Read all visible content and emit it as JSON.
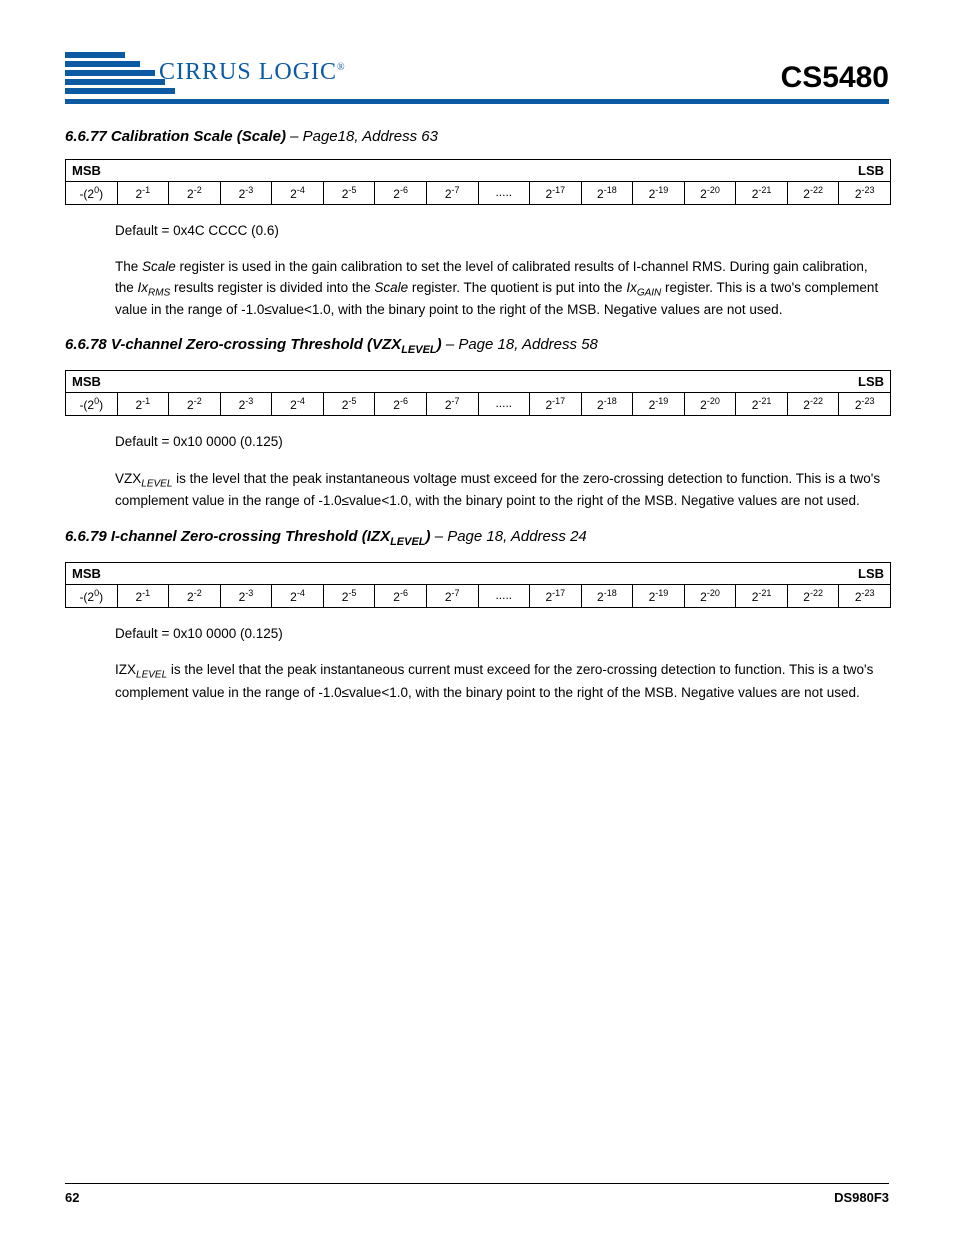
{
  "header": {
    "logo_text": "CIRRUS LOGIC",
    "chip": "CS5480"
  },
  "sections": [
    {
      "num": "6.6.77",
      "title_main": "Calibration Scale (Scale)",
      "title_suffix": " – Page18, Address 63",
      "default_line": "Default = 0x4C CCCC (0.6)",
      "body_parts": [
        "The ",
        {
          "ital": "Scale"
        },
        " register is used in the gain calibration to set the level of calibrated results of I-channel RMS. During gain calibration, the ",
        {
          "ital": "Ix"
        },
        {
          "sub": "RMS"
        },
        " results register is divided into the ",
        {
          "ital": "Scale"
        },
        " register. The quotient is put into the ",
        {
          "ital": "Ix"
        },
        {
          "sub": "GAIN"
        },
        " register. This is a two's complement value in the range of -1.0≤value<1.0, with the binary point to the right of the MSB. Negative values are not used."
      ]
    },
    {
      "num": "6.6.78",
      "title_main": "V-channel Zero-crossing Threshold (VZX",
      "title_sub": "LEVEL",
      "title_close": ")",
      "title_suffix": " – Page 18, Address 58",
      "default_line": "Default = 0x10 0000 (0.125)",
      "body_parts": [
        "VZX",
        {
          "sub": "LEVEL"
        },
        " is the level that the peak instantaneous voltage must exceed for the zero-crossing detection to function. This is a two's complement value in the range of -1.0≤value<1.0, with the binary point to the right of the MSB. Negative values are not used."
      ]
    },
    {
      "num": "6.6.79",
      "title_main": "I-channel Zero-crossing Threshold (IZX",
      "title_sub": "LEVEL",
      "title_close": ")",
      "title_suffix": " – Page 18, Address 24",
      "default_line": "Default = 0x10 0000 (0.125)",
      "body_parts": [
        "IZX",
        {
          "sub": "LEVEL"
        },
        " is the level that the peak instantaneous current must exceed for the zero-crossing detection to function. This is a two's complement value in the range of -1.0≤value<1.0, with the binary point to the right of the MSB. Negative values are not used."
      ]
    }
  ],
  "bit_labels": {
    "msb": "MSB",
    "lsb": "LSB",
    "cells": [
      {
        "text": "-(2",
        "sup": "0",
        "close": ")"
      },
      {
        "text": "2",
        "sup": "-1"
      },
      {
        "text": "2",
        "sup": "-2"
      },
      {
        "text": "2",
        "sup": "-3"
      },
      {
        "text": "2",
        "sup": "-4"
      },
      {
        "text": "2",
        "sup": "-5"
      },
      {
        "text": "2",
        "sup": "-6"
      },
      {
        "text": "2",
        "sup": "-7"
      },
      {
        "text": "....."
      },
      {
        "text": "2",
        "sup": "-17"
      },
      {
        "text": "2",
        "sup": "-18"
      },
      {
        "text": "2",
        "sup": "-19"
      },
      {
        "text": "2",
        "sup": "-20"
      },
      {
        "text": "2",
        "sup": "-21"
      },
      {
        "text": "2",
        "sup": "-22"
      },
      {
        "text": "2",
        "sup": "-23"
      }
    ]
  },
  "footer": {
    "page": "62",
    "doc": "DS980F3"
  }
}
